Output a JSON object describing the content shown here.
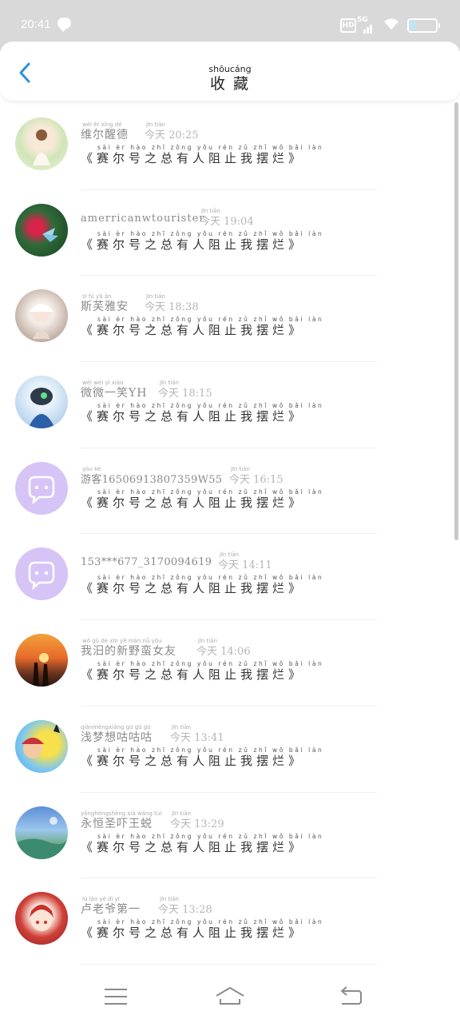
{
  "status": {
    "time": "20:41",
    "hd": "HD",
    "net": "5G"
  },
  "header": {
    "title_pinyin": "shōucáng",
    "title": "收 藏"
  },
  "content_pinyin": "sài èr hào zhī zǒng yǒu rén zǔ zhǐ wǒ bǎi làn",
  "items": [
    {
      "name": "维尔醒德",
      "name_py": "wéi ěr xǐng dé",
      "time_py": "jīn tiān",
      "time": "今天 20:25",
      "content": "《赛尔号之总有人阻止我摆烂》",
      "avatar": "girl"
    },
    {
      "name": "amerricanwtourister",
      "name_py": "",
      "time_py": "jīn tiān",
      "time": "今天 19:04",
      "content": "《赛尔号之总有人阻止我摆烂》",
      "avatar": "butterfly"
    },
    {
      "name": "斯芙雅安",
      "name_py": "sī fú yǎ ān",
      "time_py": "jīn tiān",
      "time": "今天 18:38",
      "content": "《赛尔号之总有人阻止我摆烂》",
      "avatar": "anime-white"
    },
    {
      "name": "微微一笑YH",
      "name_py": "wēi wēi yī xiào",
      "time_py": "jīn tiān",
      "time": "今天 18:15",
      "content": "《赛尔号之总有人阻止我摆烂》",
      "avatar": "robot"
    },
    {
      "name": "游客16506913807359W55",
      "name_py": "yóu kè",
      "time_py": "jīn tiān",
      "time": "今天 16:15",
      "content": "《赛尔号之总有人阻止我摆烂》",
      "avatar": "default"
    },
    {
      "name": "153***677_3170094619",
      "name_py": "",
      "time_py": "jīn tiān",
      "time": "今天 14:11",
      "content": "《赛尔号之总有人阻止我摆烂》",
      "avatar": "default"
    },
    {
      "name": "我汨的新野蛮女友",
      "name_py": "wǒ gǔ de xīn yě mán nǚ yǒu",
      "time_py": "jīn tiān",
      "time": "今天 14:06",
      "content": "《赛尔号之总有人阻止我摆烂》",
      "avatar": "sunset"
    },
    {
      "name": "浅梦想咕咕咕",
      "name_py": "qiǎnmèngxiǎng gū gū gū",
      "time_py": "jīn tiān",
      "time": "今天 13:41",
      "content": "《赛尔号之总有人阻止我摆烂》",
      "avatar": "pikachu"
    },
    {
      "name": "永恒圣吓王蜕",
      "name_py": "yǒnghéngshèng xià wáng tuì",
      "time_py": "jīn tiān",
      "time": "今天 13:29",
      "content": "《赛尔号之总有人阻止我摆烂》",
      "avatar": "landscape"
    },
    {
      "name": "卢老爷第一",
      "name_py": "lú lǎo yé dì yī",
      "time_py": "jīn tiān",
      "time": "今天 13:28",
      "content": "《赛尔号之总有人阻止我摆烂》",
      "avatar": "anime-red"
    }
  ],
  "colors": {
    "accent": "#2f8fd8",
    "status_bg": "#d9d9d9",
    "default_avatar": "#d6c4f7"
  }
}
